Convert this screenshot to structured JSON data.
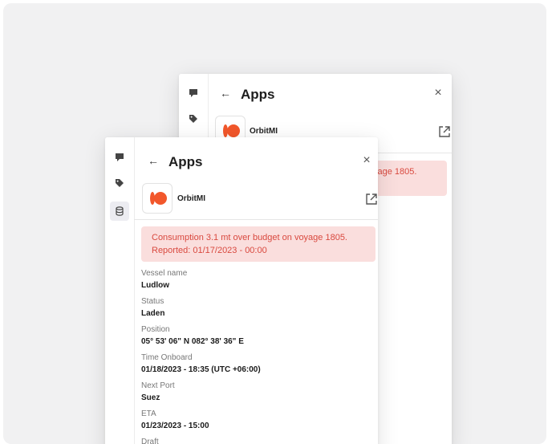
{
  "panel": {
    "title": "Apps",
    "app_name": "OrbitMI",
    "alert": {
      "line1": "Consumption 3.1 mt over budget on voyage 1805.",
      "line2": "Reported: 01/17/2023 - 00:00"
    },
    "back_panel_alert_fragment": "yage 1805.",
    "fields": [
      {
        "label": "Vessel name",
        "value": "Ludlow"
      },
      {
        "label": "Status",
        "value": "Laden"
      },
      {
        "label": "Position",
        "value": "05° 53' 06\" N 082° 38' 36\" E"
      },
      {
        "label": "Time Onboard",
        "value": "01/18/2023 - 18:35 (UTC +06:00)"
      },
      {
        "label": "Next Port",
        "value": "Suez"
      },
      {
        "label": "ETA",
        "value": "01/23/2023 - 15:00"
      },
      {
        "label": "Draft",
        "value": ""
      }
    ]
  },
  "icons": {
    "rail": [
      "comment-icon",
      "tag-icon",
      "database-icon"
    ],
    "back": "←",
    "close": "×"
  },
  "colors": {
    "alert_bg": "#fadedd",
    "alert_text": "#d9493f",
    "logo_orange": "#f2572b"
  }
}
